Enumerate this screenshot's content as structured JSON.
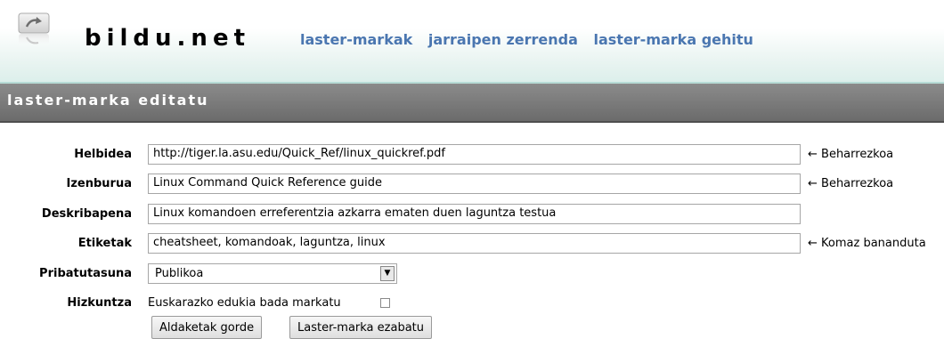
{
  "header": {
    "logo_text": "bildu.net",
    "nav": [
      "laster-markak",
      "jarraipen zerrenda",
      "laster-marka gehitu"
    ]
  },
  "page_title": "laster-marka editatu",
  "form": {
    "address": {
      "label": "Helbidea",
      "value": "http://tiger.la.asu.edu/Quick_Ref/linux_quickref.pdf",
      "hint": "← Beharrezkoa"
    },
    "title": {
      "label": "Izenburua",
      "value": "Linux Command Quick Reference guide",
      "hint": "← Beharrezkoa"
    },
    "description": {
      "label": "Deskribapena",
      "value": "Linux komandoen erreferentzia azkarra ematen duen laguntza testua"
    },
    "tags": {
      "label": "Etiketak",
      "value": "cheatsheet, komandoak, laguntza, linux",
      "hint": "← Komaz bananduta"
    },
    "privacy": {
      "label": "Pribatutasuna",
      "selected": "Publikoa"
    },
    "language": {
      "label": "Hizkuntza",
      "text": "Euskarazko edukia bada markatu",
      "checked": false
    },
    "buttons": {
      "save": "Aldaketak gorde",
      "delete": "Laster-marka ezabatu"
    }
  }
}
